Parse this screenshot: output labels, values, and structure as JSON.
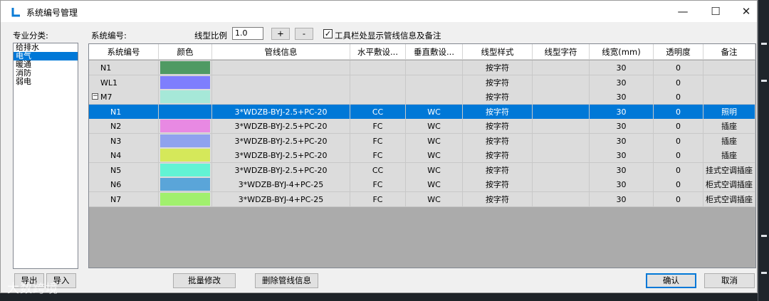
{
  "window": {
    "title": "系统编号管理",
    "min_glyph": "—",
    "max_glyph": "☐",
    "close_glyph": "✕"
  },
  "category": {
    "label": "专业分类:",
    "items": [
      "给排水",
      "电气",
      "暖通",
      "消防",
      "弱电"
    ],
    "selected": 1
  },
  "toolbar": {
    "sys_label": "系统编号:",
    "ratio_label": "线型比例",
    "ratio_value": "1.0",
    "plus": "+",
    "minus": "-",
    "show_info_checked": true,
    "show_info_label": "工具栏处显示管线信息及备注"
  },
  "table": {
    "headers": [
      "系统编号",
      "颜色",
      "管线信息",
      "水平敷设...",
      "垂直敷设...",
      "线型样式",
      "线型字符",
      "线宽(mm)",
      "透明度",
      "备注"
    ],
    "rows": [
      {
        "code": "N1",
        "color": "#4f9a63",
        "info": "",
        "h": "",
        "v": "",
        "style": "按字符",
        "chars": "",
        "width": "30",
        "alpha": "0",
        "note": ""
      },
      {
        "code": "WL1",
        "color": "#7e7efd",
        "info": "",
        "h": "",
        "v": "",
        "style": "按字符",
        "chars": "",
        "width": "30",
        "alpha": "0",
        "note": ""
      },
      {
        "code": "M7",
        "color": "#a6e8d8",
        "info": "",
        "h": "",
        "v": "",
        "style": "按字符",
        "chars": "",
        "width": "30",
        "alpha": "0",
        "note": ""
      },
      {
        "code": "N1",
        "color": "#0078d7",
        "info": "3*WDZB-BYJ-2.5+PC-20",
        "h": "CC",
        "v": "WC",
        "style": "按字符",
        "chars": "",
        "width": "30",
        "alpha": "0",
        "note": "照明"
      },
      {
        "code": "N2",
        "color": "#e889e3",
        "info": "3*WDZB-BYJ-2.5+PC-20",
        "h": "FC",
        "v": "WC",
        "style": "按字符",
        "chars": "",
        "width": "30",
        "alpha": "0",
        "note": "插座"
      },
      {
        "code": "N3",
        "color": "#8fa2ee",
        "info": "3*WDZB-BYJ-2.5+PC-20",
        "h": "FC",
        "v": "WC",
        "style": "按字符",
        "chars": "",
        "width": "30",
        "alpha": "0",
        "note": "插座"
      },
      {
        "code": "N4",
        "color": "#d5e85a",
        "info": "3*WDZB-BYJ-2.5+PC-20",
        "h": "FC",
        "v": "WC",
        "style": "按字符",
        "chars": "",
        "width": "30",
        "alpha": "0",
        "note": "插座"
      },
      {
        "code": "N5",
        "color": "#62f3d4",
        "info": "3*WDZB-BYJ-2.5+PC-20",
        "h": "CC",
        "v": "WC",
        "style": "按字符",
        "chars": "",
        "width": "30",
        "alpha": "0",
        "note": "挂式空调插座"
      },
      {
        "code": "N6",
        "color": "#5aa5d9",
        "info": "3*WDZB-BYJ-4+PC-25",
        "h": "FC",
        "v": "WC",
        "style": "按字符",
        "chars": "",
        "width": "30",
        "alpha": "0",
        "note": "柜式空调插座"
      },
      {
        "code": "N7",
        "color": "#a1f06e",
        "info": "3*WDZB-BYJ-4+PC-25",
        "h": "FC",
        "v": "WC",
        "style": "按字符",
        "chars": "",
        "width": "30",
        "alpha": "0",
        "note": "柜式空调插座"
      }
    ],
    "selected_row": 3
  },
  "footer": {
    "export": "导出",
    "import": "导入",
    "batch_edit": "批量修改",
    "delete_info": "删除管线信息",
    "ok": "确认",
    "cancel": "取消"
  },
  "watermark": "大数跨境"
}
